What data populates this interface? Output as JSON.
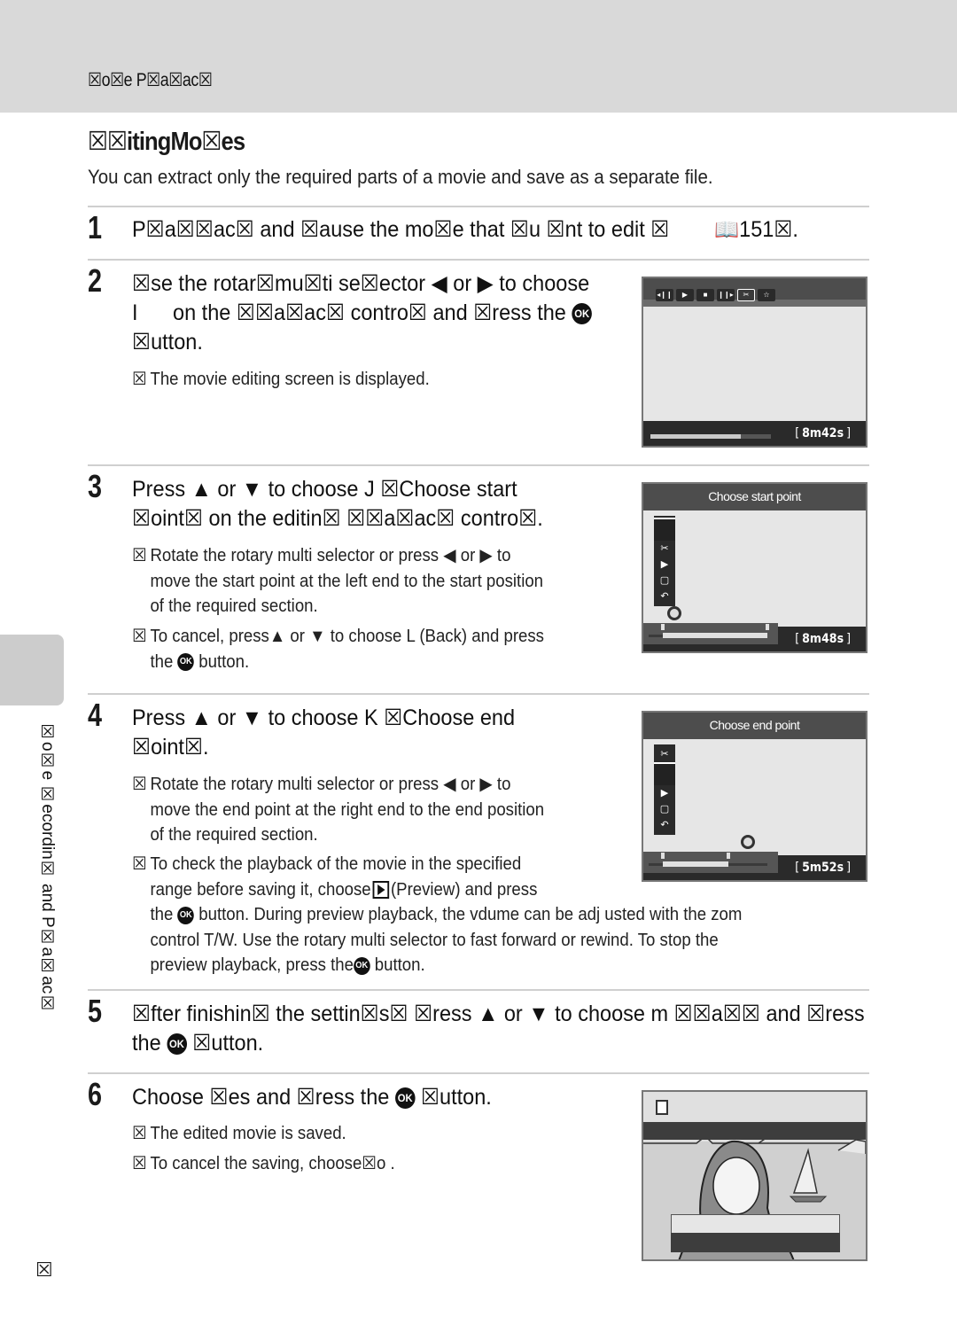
{
  "header": {
    "section": "☒o☒e P☒a☒ac☒"
  },
  "title": "☒☒itingMo☒es",
  "intro": "You can extract only the required parts of a movie and save as a separate file.",
  "steps": [
    {
      "number": "1",
      "text": "P☒a☒☒ac☒ and ☒ause the mo☒e that ☒u ☒nt to edit ☒",
      "ref_icon": "book-icon",
      "ref_page": "151☒."
    },
    {
      "number": "2",
      "line1": "☒se the rotar☒mu☒ti se☒ector ◀ or ▶ to choose",
      "line2a": "I",
      "line2b": "on the ☒☒a☒ac☒ contro☒ and ☒ress the",
      "line3": "☒utton.",
      "bullets": [
        "The movie editing screen is displayed."
      ]
    },
    {
      "number": "3",
      "line1": "Press ▲ or ▼ to choose J   ☒Choose start",
      "line2": "☒oint☒ on the editin☒ ☒☒a☒ac☒ contro☒.",
      "bullets": [
        {
          "l1": "Rotate the rotary multi selector or press ◀ or ▶ to",
          "l2": "move the start point at the left end to the start position",
          "l3": "of the required section."
        },
        {
          "l1": "To cancel,  press▲ or ▼ to choose L   (Back) and press",
          "l2a": "the",
          "l2b": "button."
        }
      ]
    },
    {
      "number": "4",
      "line1": "Press ▲ or ▼ to choose K  ☒Choose end",
      "line2": "☒oint☒.",
      "bullets": [
        {
          "l1": "Rotate the rotary multi selector or press ◀ or ▶ to",
          "l2": "move the end point at the right end to the end position",
          "l3": "of the required section."
        },
        {
          "l1": "To check the playback of the movie in the specified",
          "l2a": "range before saving it,  choose",
          "l2b": "(Preview) and press",
          "l3a": "the",
          "l3b": "button. During preview playback,  the vdume can be adj usted with the zom",
          "l4": "control T/W. Use the rotary multi selector to fast forward or rewind. To stop the",
          "l5a": "preview playback,  press the",
          "l5b": "button."
        }
      ]
    },
    {
      "number": "5",
      "line1": "☒fter finishin☒ the settin☒s☒ ☒ress ▲ or ▼ to choose m ☒☒a☒☒ and ☒ress",
      "line2a": "the",
      "line2b": "☒utton."
    },
    {
      "number": "6",
      "line1a": "Choose ☒es  and ☒ress the",
      "line1b": "☒utton.",
      "bullets": [
        "The edited movie is saved.",
        "To cancel the saving,  choose☒o ."
      ]
    }
  ],
  "bullet_mark": "☒",
  "ok_label": "OK",
  "screens": {
    "playback": {
      "toolbar": [
        "◂❙❙",
        "▶",
        "■",
        "❙❙▸",
        "✂",
        "☆"
      ],
      "selected_tool": 4,
      "time": "8m42s",
      "progress": 0.75
    },
    "start_point": {
      "title": "Choose    start    point",
      "menu": [
        "",
        "✂",
        "▶",
        "▢",
        "↶"
      ],
      "time": "8m48s",
      "start_fraction": 0.12,
      "end_fraction": 1.0
    },
    "end_point": {
      "title": "Choose     end    point",
      "menu": [
        "✂",
        "",
        "▶",
        "▢",
        "↶"
      ],
      "time": "5m52s",
      "start_fraction": 0.12,
      "end_fraction": 0.67
    },
    "save": {
      "icon": "save-icon"
    }
  },
  "side_label": "☒o☒e ☒ecordin☒ and P☒a☒ac☒",
  "page_number": "☒"
}
